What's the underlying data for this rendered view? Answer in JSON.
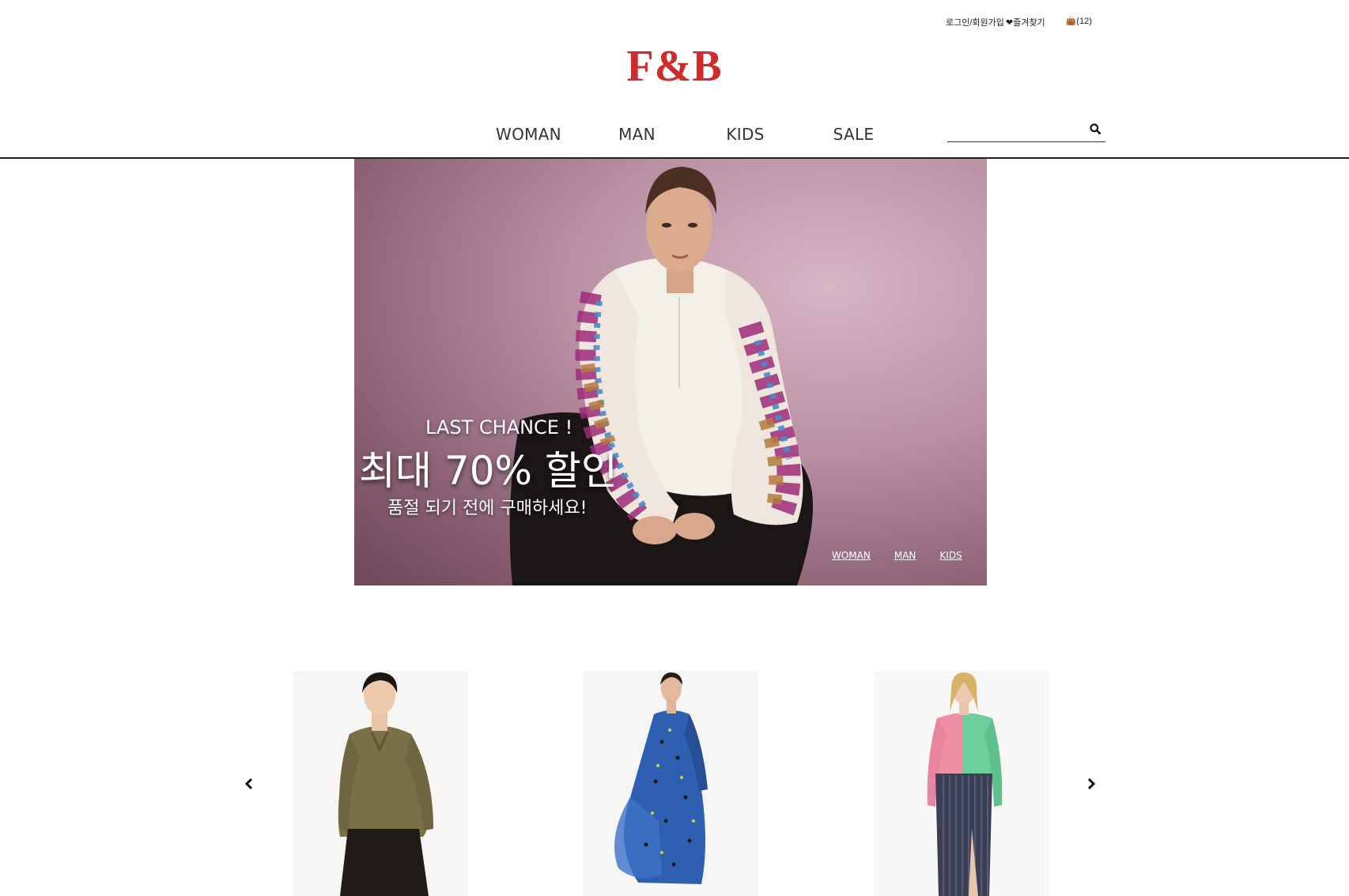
{
  "utility": {
    "login": "로그인/회원가입",
    "favorites": "❤즐겨찾기",
    "cart": "👜(12)"
  },
  "brand": {
    "logo": "F&B",
    "color": "#cf2b2b"
  },
  "nav": {
    "items": [
      {
        "label": "WOMAN"
      },
      {
        "label": "MAN"
      },
      {
        "label": "KIDS"
      },
      {
        "label": "SALE"
      }
    ]
  },
  "search": {
    "placeholder": "",
    "icon": "search-icon"
  },
  "hero": {
    "headline": "LAST CHANCE !",
    "discount": "최대 70% 할인",
    "subtext": "품절 되기 전에 구매하세요!",
    "links": [
      {
        "label": "WOMAN"
      },
      {
        "label": "MAN"
      },
      {
        "label": "KIDS"
      }
    ]
  },
  "products": {
    "prev_icon": "chevron-left-icon",
    "next_icon": "chevron-right-icon",
    "items": [
      {
        "image": "woman-khaki-satin-shirt"
      },
      {
        "image": "woman-blue-print-dress"
      },
      {
        "image": "woman-colorblock-dress"
      }
    ]
  }
}
